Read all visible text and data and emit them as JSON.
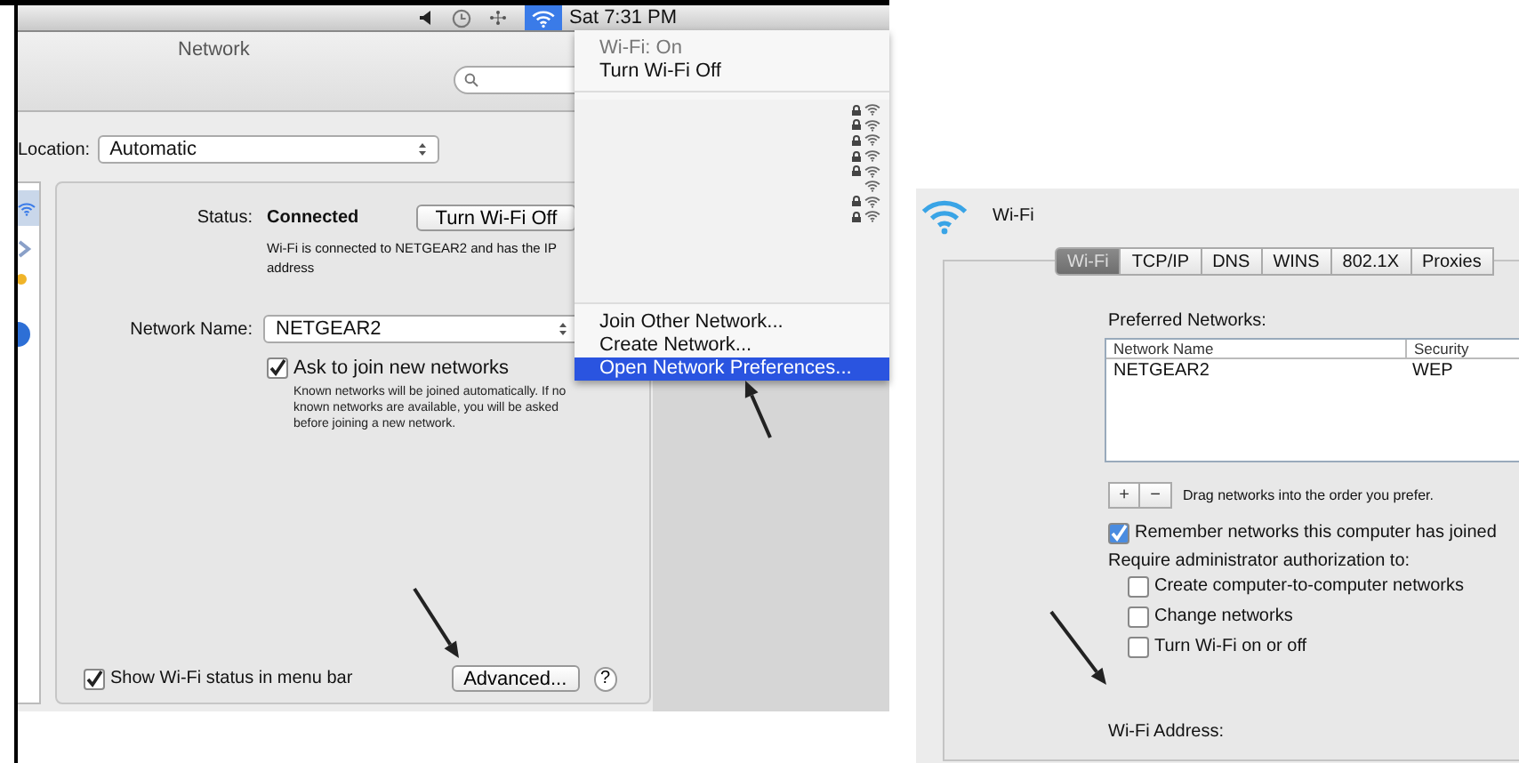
{
  "menu_bar": {
    "clock": "Sat 7:31 PM"
  },
  "network_window": {
    "title": "Network",
    "location": {
      "label": "Location:",
      "value": "Automatic"
    },
    "status": {
      "label": "Status:",
      "value": "Connected",
      "button": "Turn Wi-Fi Off",
      "description": "Wi-Fi is connected to NETGEAR2 and has the IP address"
    },
    "network_name": {
      "label": "Network Name:",
      "value": "NETGEAR2"
    },
    "ask_to_join": {
      "label": "Ask to join new networks",
      "checked": true,
      "hint": "Known networks will be joined automatically. If no known networks are available, you will be asked before joining a new network."
    },
    "show_status": {
      "label": "Show Wi-Fi status in menu bar",
      "checked": true
    },
    "advanced_button": "Advanced...",
    "help_button": "?"
  },
  "wifi_menu": {
    "status": "Wi-Fi: On",
    "toggle": "Turn Wi-Fi Off",
    "networks": [
      {
        "locked": true
      },
      {
        "locked": true
      },
      {
        "locked": true
      },
      {
        "locked": true
      },
      {
        "locked": true
      },
      {
        "locked": false
      },
      {
        "locked": true
      },
      {
        "locked": true
      }
    ],
    "actions": [
      {
        "label": "Join Other Network...",
        "selected": false
      },
      {
        "label": "Create Network...",
        "selected": false
      },
      {
        "label": "Open Network Preferences...",
        "selected": true
      }
    ]
  },
  "advanced": {
    "title": "Wi-Fi",
    "tabs": [
      {
        "label": "Wi-Fi",
        "selected": true
      },
      {
        "label": "TCP/IP",
        "selected": false
      },
      {
        "label": "DNS",
        "selected": false
      },
      {
        "label": "WINS",
        "selected": false
      },
      {
        "label": "802.1X",
        "selected": false
      },
      {
        "label": "Proxies",
        "selected": false
      }
    ],
    "preferred_label": "Preferred Networks:",
    "columns": [
      "Network Name",
      "Security"
    ],
    "rows": [
      [
        "NETGEAR2",
        "WEP"
      ]
    ],
    "add_button": "+",
    "remove_button": "−",
    "drag_hint": "Drag networks into the order you prefer.",
    "remember": {
      "label": "Remember networks this computer has joined",
      "checked": true
    },
    "require_label": "Require administrator authorization to:",
    "auth_options": [
      {
        "label": "Create computer-to-computer networks",
        "checked": false
      },
      {
        "label": "Change networks",
        "checked": false
      },
      {
        "label": "Turn Wi-Fi on or off",
        "checked": false
      }
    ],
    "address_label": "Wi-Fi Address:"
  }
}
